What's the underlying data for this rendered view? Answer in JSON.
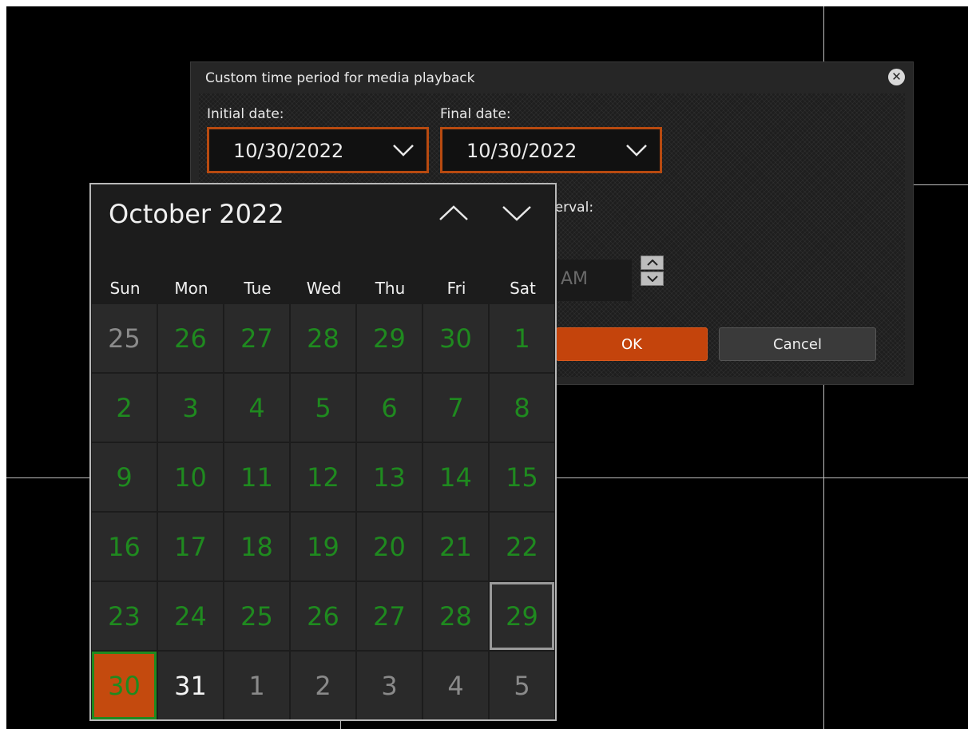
{
  "dialog": {
    "title": "Custom time period for media playback",
    "initial_label": "Initial date:",
    "initial_value": "10/30/2022",
    "final_label": "Final date:",
    "final_value": "10/30/2022",
    "interval_label_partial": "terval:",
    "time_value_partial": "AM",
    "ok_label": "OK",
    "cancel_label": "Cancel"
  },
  "calendar": {
    "month_label": "October 2022",
    "weekdays": [
      "Sun",
      "Mon",
      "Tue",
      "Wed",
      "Thu",
      "Fri",
      "Sat"
    ],
    "weeks": [
      [
        [
          "25",
          "other"
        ],
        [
          "26",
          "inmonth"
        ],
        [
          "27",
          "inmonth"
        ],
        [
          "28",
          "inmonth"
        ],
        [
          "29",
          "inmonth"
        ],
        [
          "30",
          "inmonth"
        ],
        [
          "1",
          "inmonth"
        ]
      ],
      [
        [
          "2",
          "inmonth"
        ],
        [
          "3",
          "inmonth"
        ],
        [
          "4",
          "inmonth"
        ],
        [
          "5",
          "inmonth"
        ],
        [
          "6",
          "inmonth"
        ],
        [
          "7",
          "inmonth"
        ],
        [
          "8",
          "inmonth"
        ]
      ],
      [
        [
          "9",
          "inmonth"
        ],
        [
          "10",
          "inmonth"
        ],
        [
          "11",
          "inmonth"
        ],
        [
          "12",
          "inmonth"
        ],
        [
          "13",
          "inmonth"
        ],
        [
          "14",
          "inmonth"
        ],
        [
          "15",
          "inmonth"
        ]
      ],
      [
        [
          "16",
          "inmonth"
        ],
        [
          "17",
          "inmonth"
        ],
        [
          "18",
          "inmonth"
        ],
        [
          "19",
          "inmonth"
        ],
        [
          "20",
          "inmonth"
        ],
        [
          "21",
          "inmonth"
        ],
        [
          "22",
          "inmonth"
        ]
      ],
      [
        [
          "23",
          "inmonth"
        ],
        [
          "24",
          "inmonth"
        ],
        [
          "25",
          "inmonth"
        ],
        [
          "26",
          "inmonth"
        ],
        [
          "27",
          "inmonth"
        ],
        [
          "28",
          "inmonth"
        ],
        [
          "29",
          "inmonth hover"
        ]
      ],
      [
        [
          "30",
          "inmonth today"
        ],
        [
          "31",
          "plain"
        ],
        [
          "1",
          "other"
        ],
        [
          "2",
          "other"
        ],
        [
          "3",
          "other"
        ],
        [
          "4",
          "other"
        ],
        [
          "5",
          "other"
        ]
      ]
    ]
  },
  "colors": {
    "accent": "#c44a0e",
    "available_day": "#1f8a1f",
    "background": "#000000"
  }
}
